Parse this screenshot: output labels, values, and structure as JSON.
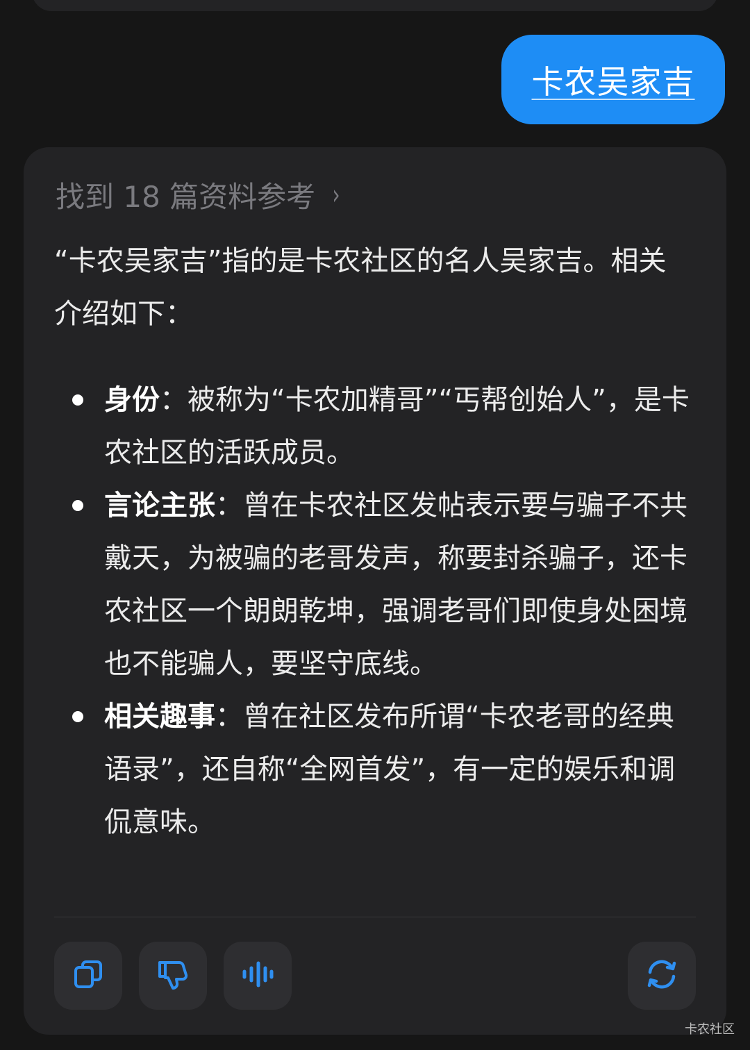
{
  "user_message": {
    "text": "卡农吴家吉"
  },
  "answer": {
    "references_label": "找到 18 篇资料参考",
    "references_chevron": "›",
    "intro": "“卡农吴家吉”指的是卡农社区的名人吴家吉。相关介绍如下：",
    "bullets": [
      {
        "title": "身份",
        "separator": "：",
        "text": "被称为“卡农加精哥”“丐帮创始人”，是卡农社区的活跃成员。"
      },
      {
        "title": "言论主张",
        "separator": "：",
        "text": "曾在卡农社区发帖表示要与骗子不共戴天，为被骗的老哥发声，称要封杀骗子，还卡农社区一个朗朗乾坤，强调老哥们即使身处困境也不能骗人，要坚守底线。"
      },
      {
        "title": "相关趣事",
        "separator": "：",
        "text": "曾在社区发布所谓“卡农老哥的经典语录”，还自称“全网首发”，有一定的娱乐和调侃意味。"
      }
    ]
  },
  "actions": {
    "copy_icon": "copy-icon",
    "dislike_icon": "thumbs-down-icon",
    "voice_icon": "audio-wave-icon",
    "regenerate_icon": "refresh-icon"
  },
  "watermark": "卡农社区",
  "colors": {
    "background": "#161616",
    "card": "#232325",
    "user_bubble": "#1e8df5",
    "icon_blue": "#2f8ff0",
    "button_bg": "#2e2e31",
    "muted_text": "#7a7a7f"
  }
}
